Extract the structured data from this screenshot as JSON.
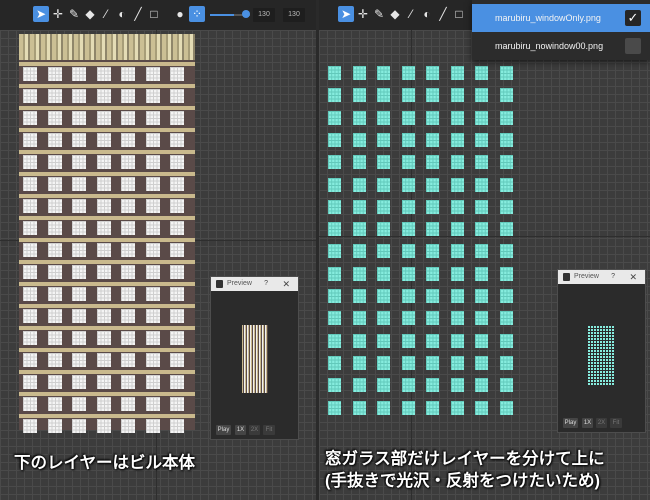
{
  "toolbar": {
    "tools": [
      "pointer-icon",
      "move-icon",
      "pencil-icon",
      "eraser-icon",
      "eyedropper-icon",
      "fill-icon",
      "line-icon",
      "rect-icon"
    ],
    "active_tool": "pointer-icon",
    "extra": [
      "circle-icon",
      "dither-icon"
    ],
    "zoom_slider_percent": 60,
    "width_value": "130",
    "height_value": "130"
  },
  "preview": {
    "title": "Preview",
    "help": "?",
    "close": "✕",
    "buttons": [
      "Play",
      "1X",
      "2X",
      "Fit"
    ]
  },
  "file_menu": {
    "items": [
      {
        "name": "marubiru_windowOnly.png",
        "checked": true
      },
      {
        "name": "marubiru_nowindow00.png",
        "checked": false
      }
    ]
  },
  "captions": {
    "left": "下のレイヤーはビル本体",
    "right_line1": "窓ガラス部だけレイヤーを分けて上に",
    "right_line2": "(手抜きで光沢・反射をつけたいため)"
  },
  "colors": {
    "accent": "#4a90e2",
    "glass": "#86ecde",
    "beam": "#c9b98d",
    "building": "#5a4a48"
  }
}
